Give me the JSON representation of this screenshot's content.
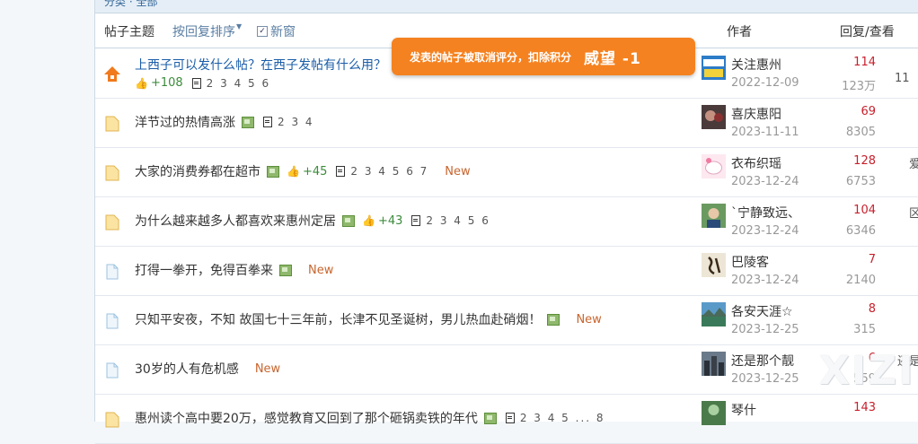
{
  "breadcrumb": "分类  ·  全部",
  "header": {
    "subject": "帖子主题",
    "sort": "按回复排序",
    "new_window": "新窗",
    "author": "作者",
    "reply_view": "回复/查看"
  },
  "toast": {
    "message": "发表的帖子被取消评分，扣除积分",
    "score": "威望 -1"
  },
  "watermark": "XIZI",
  "threads": [
    {
      "title": "上西子可以发什么帖？在西子发帖有什么用？",
      "icon": "hot-icon",
      "thumb": "+108",
      "pages": "2 3 4 5 6",
      "author": "关注惠州",
      "date": "2022-12-09",
      "replies": "114",
      "views": "123万",
      "last": "11"
    },
    {
      "title": "洋节过的热情高涨",
      "icon": "folder-icon",
      "pages": "2 3 4",
      "author": "喜庆惠阳",
      "date": "2023-11-11",
      "replies": "69",
      "views": "8305"
    },
    {
      "title": "大家的消费券都在超市",
      "icon": "folder-icon",
      "thumb": "+45",
      "pages": "2 3 4 5 6 7",
      "new": "New",
      "author": "衣布织瑶",
      "date": "2023-12-24",
      "replies": "128",
      "views": "6753",
      "last": "爱"
    },
    {
      "title": "为什么越来越多人都喜欢来惠州定居",
      "icon": "folder-icon",
      "thumb": "+43",
      "pages": "2 3 4 5 6",
      "author": "`宁静致远、",
      "date": "2023-12-24",
      "replies": "104",
      "views": "6346",
      "last": "区"
    },
    {
      "title": "打得一拳开，免得百拳来",
      "icon": "doc-icon",
      "new": "New",
      "author": "巴陵客",
      "date": "2023-12-24",
      "replies": "7",
      "views": "2140"
    },
    {
      "title": "只知平安夜，不知 故国七十三年前，长津不见圣诞树，男儿热血赴硝烟！",
      "icon": "doc-icon",
      "new": "New",
      "author": "各安天涯☆",
      "date": "2023-12-25",
      "replies": "8",
      "views": "315"
    },
    {
      "title": "30岁的人有危机感",
      "icon": "doc-icon",
      "new": "New",
      "author": "还是那个靓",
      "date": "2023-12-25",
      "replies": "6",
      "views": "559",
      "last": "还是"
    },
    {
      "title": "惠州读个高中要20万，感觉教育又回到了那个砸锅卖铁的年代",
      "icon": "folder-icon",
      "pages": "2 3 4 5 ... 8",
      "author": "琴什",
      "date": "",
      "replies": "143",
      "views": ""
    }
  ]
}
